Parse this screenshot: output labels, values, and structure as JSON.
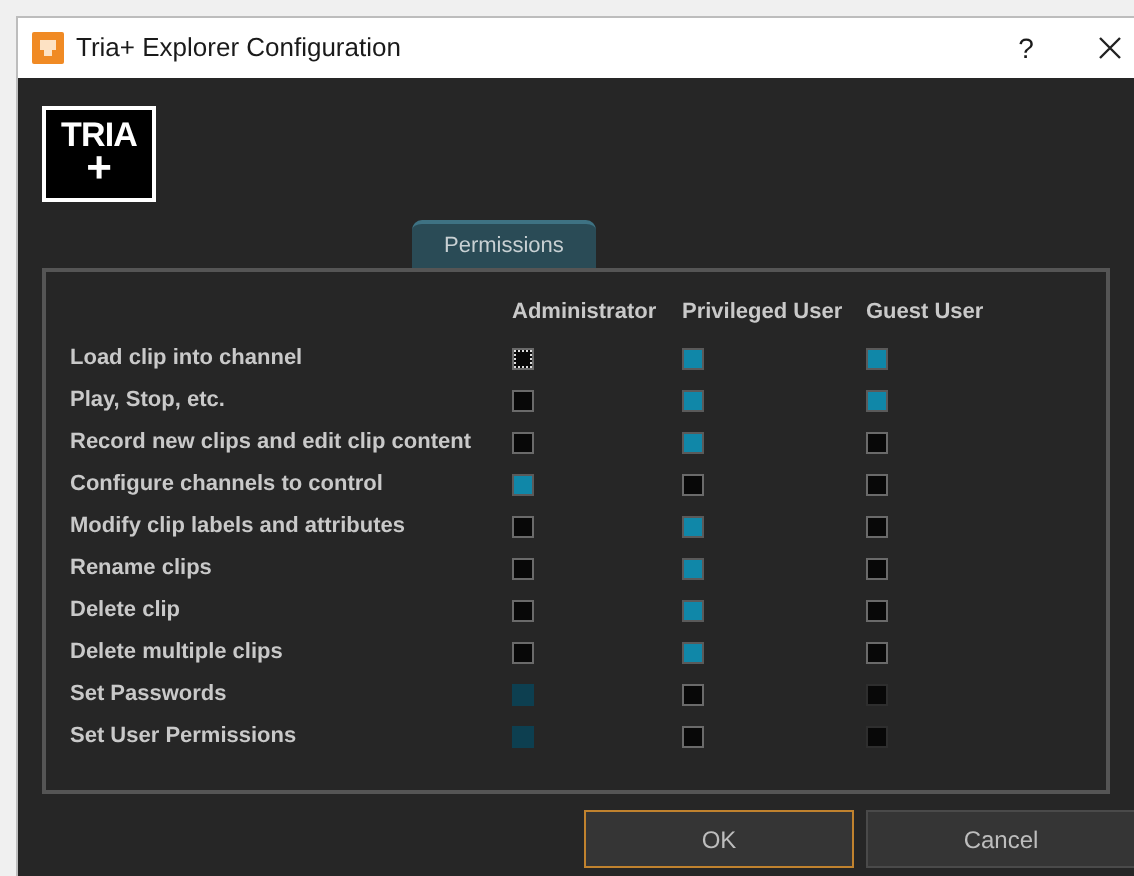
{
  "window": {
    "title": "Tria+ Explorer Configuration",
    "help": "?"
  },
  "logo": {
    "line1": "TRIA",
    "line2": "+"
  },
  "tabs": [
    {
      "label": "Permissions",
      "selected": true
    }
  ],
  "table": {
    "columns": [
      "Administrator",
      "Privileged User",
      "Guest User"
    ],
    "rows": [
      {
        "label": "Load clip into channel",
        "cells": [
          {
            "checked": false,
            "disabled": false,
            "focused": true
          },
          {
            "checked": true,
            "disabled": false,
            "focused": false
          },
          {
            "checked": true,
            "disabled": false,
            "focused": false
          }
        ]
      },
      {
        "label": "Play, Stop, etc.",
        "cells": [
          {
            "checked": false,
            "disabled": false,
            "focused": false
          },
          {
            "checked": true,
            "disabled": false,
            "focused": false
          },
          {
            "checked": true,
            "disabled": false,
            "focused": false
          }
        ]
      },
      {
        "label": "Record new clips and edit clip content",
        "cells": [
          {
            "checked": false,
            "disabled": false,
            "focused": false
          },
          {
            "checked": true,
            "disabled": false,
            "focused": false
          },
          {
            "checked": false,
            "disabled": false,
            "focused": false
          }
        ]
      },
      {
        "label": "Configure channels to control",
        "cells": [
          {
            "checked": true,
            "disabled": false,
            "focused": false
          },
          {
            "checked": false,
            "disabled": false,
            "focused": false
          },
          {
            "checked": false,
            "disabled": false,
            "focused": false
          }
        ]
      },
      {
        "label": "Modify clip labels and attributes",
        "cells": [
          {
            "checked": false,
            "disabled": false,
            "focused": false
          },
          {
            "checked": true,
            "disabled": false,
            "focused": false
          },
          {
            "checked": false,
            "disabled": false,
            "focused": false
          }
        ]
      },
      {
        "label": "Rename clips",
        "cells": [
          {
            "checked": false,
            "disabled": false,
            "focused": false
          },
          {
            "checked": true,
            "disabled": false,
            "focused": false
          },
          {
            "checked": false,
            "disabled": false,
            "focused": false
          }
        ]
      },
      {
        "label": "Delete clip",
        "cells": [
          {
            "checked": false,
            "disabled": false,
            "focused": false
          },
          {
            "checked": true,
            "disabled": false,
            "focused": false
          },
          {
            "checked": false,
            "disabled": false,
            "focused": false
          }
        ]
      },
      {
        "label": "Delete multiple clips",
        "cells": [
          {
            "checked": false,
            "disabled": false,
            "focused": false
          },
          {
            "checked": true,
            "disabled": false,
            "focused": false
          },
          {
            "checked": false,
            "disabled": false,
            "focused": false
          }
        ]
      },
      {
        "label": "Set Passwords",
        "cells": [
          {
            "checked": true,
            "disabled": true,
            "focused": false
          },
          {
            "checked": false,
            "disabled": false,
            "focused": false
          },
          {
            "checked": false,
            "disabled": true,
            "focused": false
          }
        ]
      },
      {
        "label": "Set User Permissions",
        "cells": [
          {
            "checked": true,
            "disabled": true,
            "focused": false
          },
          {
            "checked": false,
            "disabled": false,
            "focused": false
          },
          {
            "checked": false,
            "disabled": true,
            "focused": false
          }
        ]
      }
    ]
  },
  "buttons": [
    {
      "label": "OK",
      "default": true
    },
    {
      "label": "Cancel",
      "default": false
    }
  ]
}
